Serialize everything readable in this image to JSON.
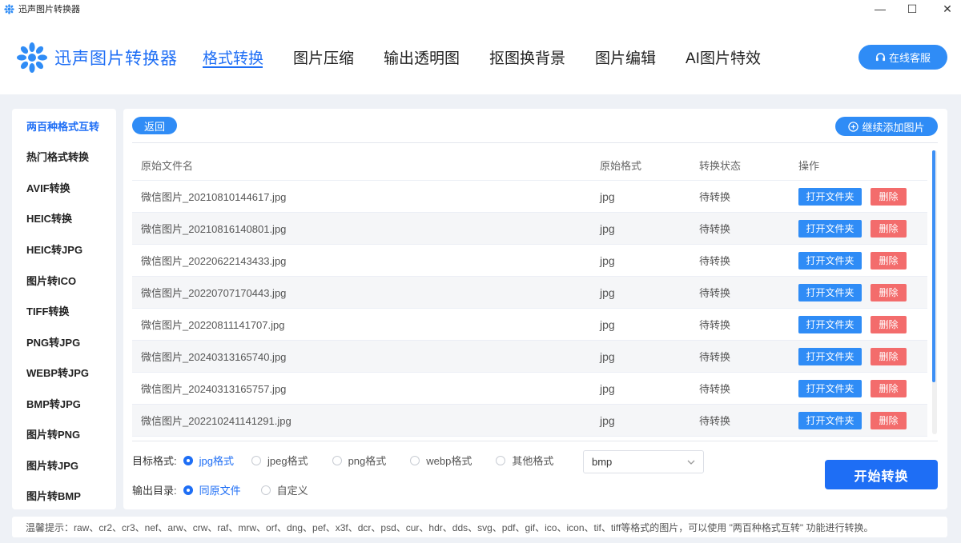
{
  "window": {
    "title": "迅声图片转换器",
    "controls": {
      "minimize": "—",
      "maximize": "☐",
      "close": "✕"
    }
  },
  "header": {
    "brand": "迅声图片转换器",
    "tabs": [
      {
        "label": "格式转换",
        "active": true
      },
      {
        "label": "图片压缩",
        "active": false
      },
      {
        "label": "输出透明图",
        "active": false
      },
      {
        "label": "抠图换背景",
        "active": false
      },
      {
        "label": "图片编辑",
        "active": false
      },
      {
        "label": "AI图片特效",
        "active": false
      }
    ],
    "service_label": "在线客服",
    "service_icon": "headset-icon",
    "accent_color": "#1e6ef5"
  },
  "sidebar": {
    "items": [
      {
        "label": "两百种格式互转",
        "active": true
      },
      {
        "label": "热门格式转换",
        "active": false
      },
      {
        "label": "AVIF转换",
        "active": false
      },
      {
        "label": "HEIC转换",
        "active": false
      },
      {
        "label": "HEIC转JPG",
        "active": false
      },
      {
        "label": "图片转ICO",
        "active": false
      },
      {
        "label": "TIFF转换",
        "active": false
      },
      {
        "label": "PNG转JPG",
        "active": false
      },
      {
        "label": "WEBP转JPG",
        "active": false
      },
      {
        "label": "BMP转JPG",
        "active": false
      },
      {
        "label": "图片转PNG",
        "active": false
      },
      {
        "label": "图片转JPG",
        "active": false
      },
      {
        "label": "图片转BMP",
        "active": false
      }
    ]
  },
  "main": {
    "back_label": "返回",
    "add_label": "继续添加图片",
    "table": {
      "headers": [
        "原始文件名",
        "原始格式",
        "转换状态",
        "操作"
      ],
      "open_label": "打开文件夹",
      "delete_label": "删除",
      "rows": [
        {
          "name": "微信图片_20210810144617.jpg",
          "format": "jpg",
          "status": "待转换"
        },
        {
          "name": "微信图片_20210816140801.jpg",
          "format": "jpg",
          "status": "待转换"
        },
        {
          "name": "微信图片_20220622143433.jpg",
          "format": "jpg",
          "status": "待转换"
        },
        {
          "name": "微信图片_20220707170443.jpg",
          "format": "jpg",
          "status": "待转换"
        },
        {
          "name": "微信图片_20220811141707.jpg",
          "format": "jpg",
          "status": "待转换"
        },
        {
          "name": "微信图片_20240313165740.jpg",
          "format": "jpg",
          "status": "待转换"
        },
        {
          "name": "微信图片_20240313165757.jpg",
          "format": "jpg",
          "status": "待转换"
        },
        {
          "name": "微信图片_202210241141291.jpg",
          "format": "jpg",
          "status": "待转换"
        }
      ]
    },
    "target_format": {
      "label": "目标格式:",
      "options": [
        {
          "label": "jpg格式",
          "checked": true
        },
        {
          "label": "jpeg格式",
          "checked": false
        },
        {
          "label": "png格式",
          "checked": false
        },
        {
          "label": "webp格式",
          "checked": false
        },
        {
          "label": "其他格式",
          "checked": false
        }
      ],
      "other_value": "bmp"
    },
    "output_dir": {
      "label": "输出目录:",
      "options": [
        {
          "label": "同原文件",
          "checked": true
        },
        {
          "label": "自定义",
          "checked": false
        }
      ]
    },
    "start_label": "开始转换"
  },
  "tip": "温馨提示：raw、cr2、cr3、nef、arw、crw、raf、mrw、orf、dng、pef、x3f、dcr、psd、cur、hdr、dds、svg、pdf、gif、ico、icon、tif、tiff等格式的图片，可以使用 \"两百种格式互转\" 功能进行转换。"
}
